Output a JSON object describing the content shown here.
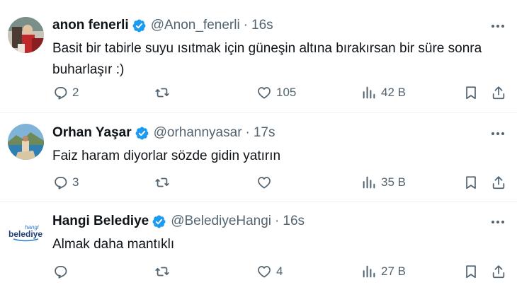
{
  "tweets": [
    {
      "name": "anon fenerli",
      "handle": "@Anon_fenerli",
      "time": "16s",
      "text": "Basit bir tabirle suyu ısıtmak için güneşin altına bırakırsan bir süre sonra buharlaşır :)",
      "replies": "2",
      "retweets": "",
      "likes": "105",
      "views": "42 B"
    },
    {
      "name": "Orhan Yaşar",
      "handle": "@orhannyasar",
      "time": "17s",
      "text": "Faiz haram diyorlar sözde gidin yatırın",
      "replies": "3",
      "retweets": "",
      "likes": "",
      "views": "35 B"
    },
    {
      "name": "Hangi Belediye",
      "handle": "@BelediyeHangi",
      "time": "16s",
      "text": "Almak daha mantıklı",
      "replies": "",
      "retweets": "",
      "likes": "4",
      "views": "27 B",
      "avatar_logo_text": "hangi belediye"
    }
  ],
  "separator": "·",
  "colors": {
    "verified": "#1d9bf0",
    "muted": "#536471",
    "text": "#0f1419"
  },
  "icons": [
    "verified-badge-icon",
    "more-icon",
    "reply-icon",
    "retweet-icon",
    "like-icon",
    "views-icon",
    "bookmark-icon",
    "share-icon"
  ]
}
